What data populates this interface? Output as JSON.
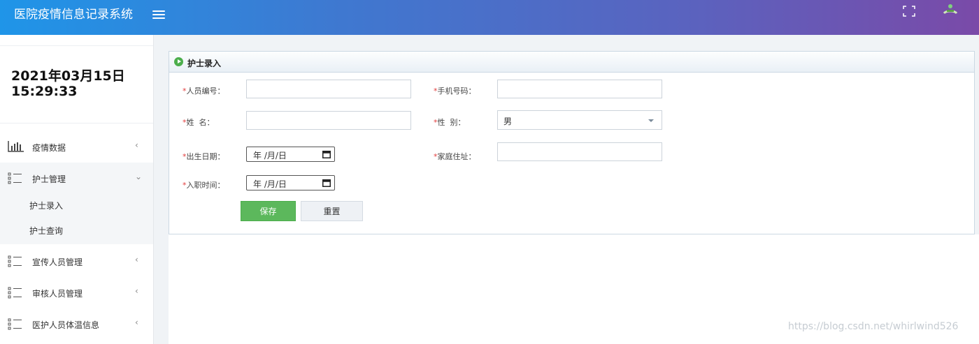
{
  "header": {
    "app_title": "医院疫情信息记录系统",
    "menu_toggle_icon": "hamburger-icon",
    "fullscreen_icon": "fullscreen-icon",
    "avatar_icon": "user-avatar-icon"
  },
  "clock": {
    "date": "2021年03月15日",
    "time": "15:29:33"
  },
  "sidebar": {
    "items": [
      {
        "label": "疫情数据",
        "icon": "bar-chart-icon",
        "chevron": "‹"
      },
      {
        "label": "护士管理",
        "icon": "list-icon",
        "chevron": "⌄",
        "open": true,
        "children": [
          {
            "label": "护士录入"
          },
          {
            "label": "护士查询"
          }
        ]
      },
      {
        "label": "宣传人员管理",
        "icon": "list-icon",
        "chevron": "‹"
      },
      {
        "label": "审核人员管理",
        "icon": "list-icon",
        "chevron": "‹"
      },
      {
        "label": "医护人员体温信息",
        "icon": "list-icon",
        "chevron": "‹"
      }
    ]
  },
  "panel": {
    "title": "护士录入",
    "icon": "play-circle-icon"
  },
  "form": {
    "required_mark": "*",
    "staff_id_label": "人员编号：",
    "staff_id_value": "",
    "phone_label": "手机号码：",
    "phone_value": "",
    "name_label": "姓  名：",
    "name_value": "",
    "gender_label": "性  别：",
    "gender_value": "男",
    "birth_label": "出生日期：",
    "birth_value": "年 /月/日",
    "address_label": "家庭住址：",
    "address_value": "",
    "hire_label": "入职时间：",
    "hire_value": "年 /月/日",
    "save_label": "保存",
    "reset_label": "重置"
  },
  "watermark": "https://blog.csdn.net/whirlwind526",
  "colors": {
    "header_start": "#1f95e8",
    "header_end": "#7a4aa8",
    "save_button": "#5cb85c",
    "required": "#e23c3c"
  }
}
